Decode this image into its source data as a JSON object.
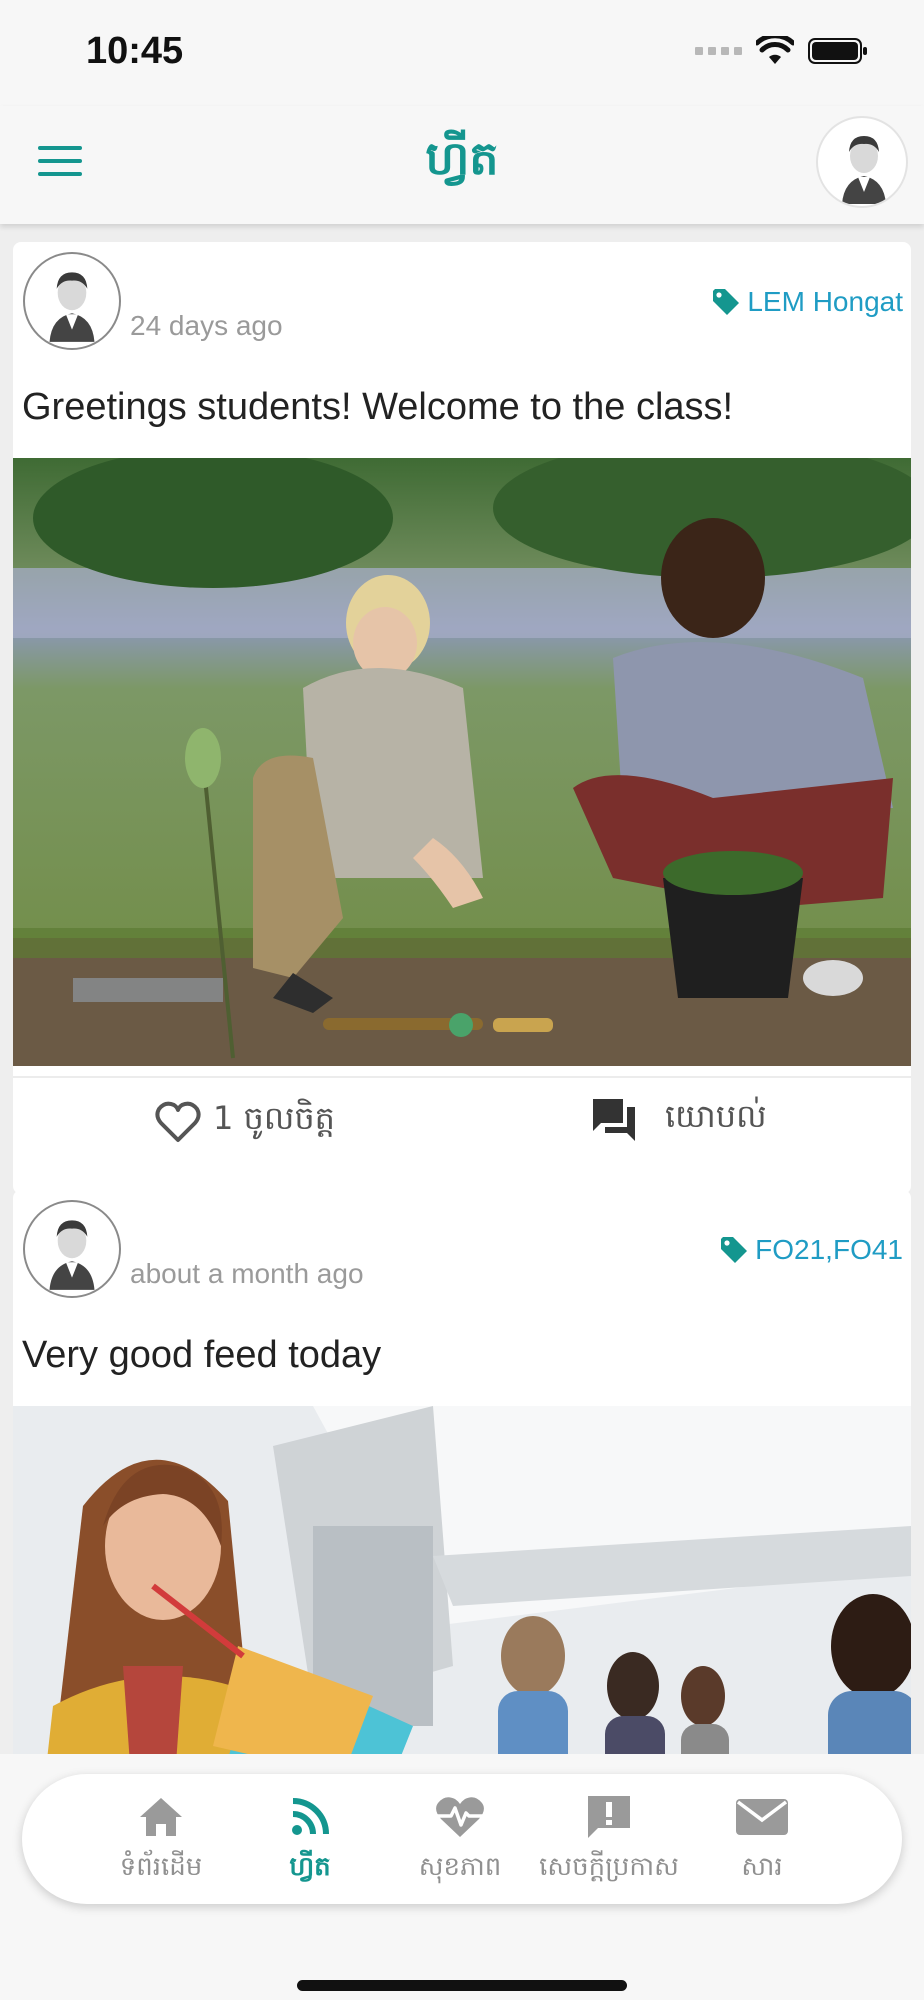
{
  "status_bar": {
    "time": "10:45"
  },
  "header": {
    "title": "ហ្វីត"
  },
  "posts": [
    {
      "time": "24 days ago",
      "tag": "LEM Hongat",
      "text": "Greetings students! Welcome to the class!",
      "like_label": "1 ចូលចិត្ត",
      "comment_label": "យោបល់"
    },
    {
      "time": "about a month ago",
      "tag": "FO21,FO41",
      "text": "Very good feed today"
    }
  ],
  "bottom_nav": {
    "items": [
      {
        "label": "ទំព័រដើម",
        "icon": "home-icon"
      },
      {
        "label": "ហ្វីត",
        "icon": "rss-icon",
        "active": true
      },
      {
        "label": "សុខភាព",
        "icon": "heartbeat-icon"
      },
      {
        "label": "សេចក្តីប្រកាស",
        "icon": "announcement-icon"
      },
      {
        "label": "សារ",
        "icon": "mail-icon"
      }
    ]
  },
  "colors": {
    "accent": "#14968f",
    "tag": "#1f9cc4",
    "muted": "#909090"
  }
}
